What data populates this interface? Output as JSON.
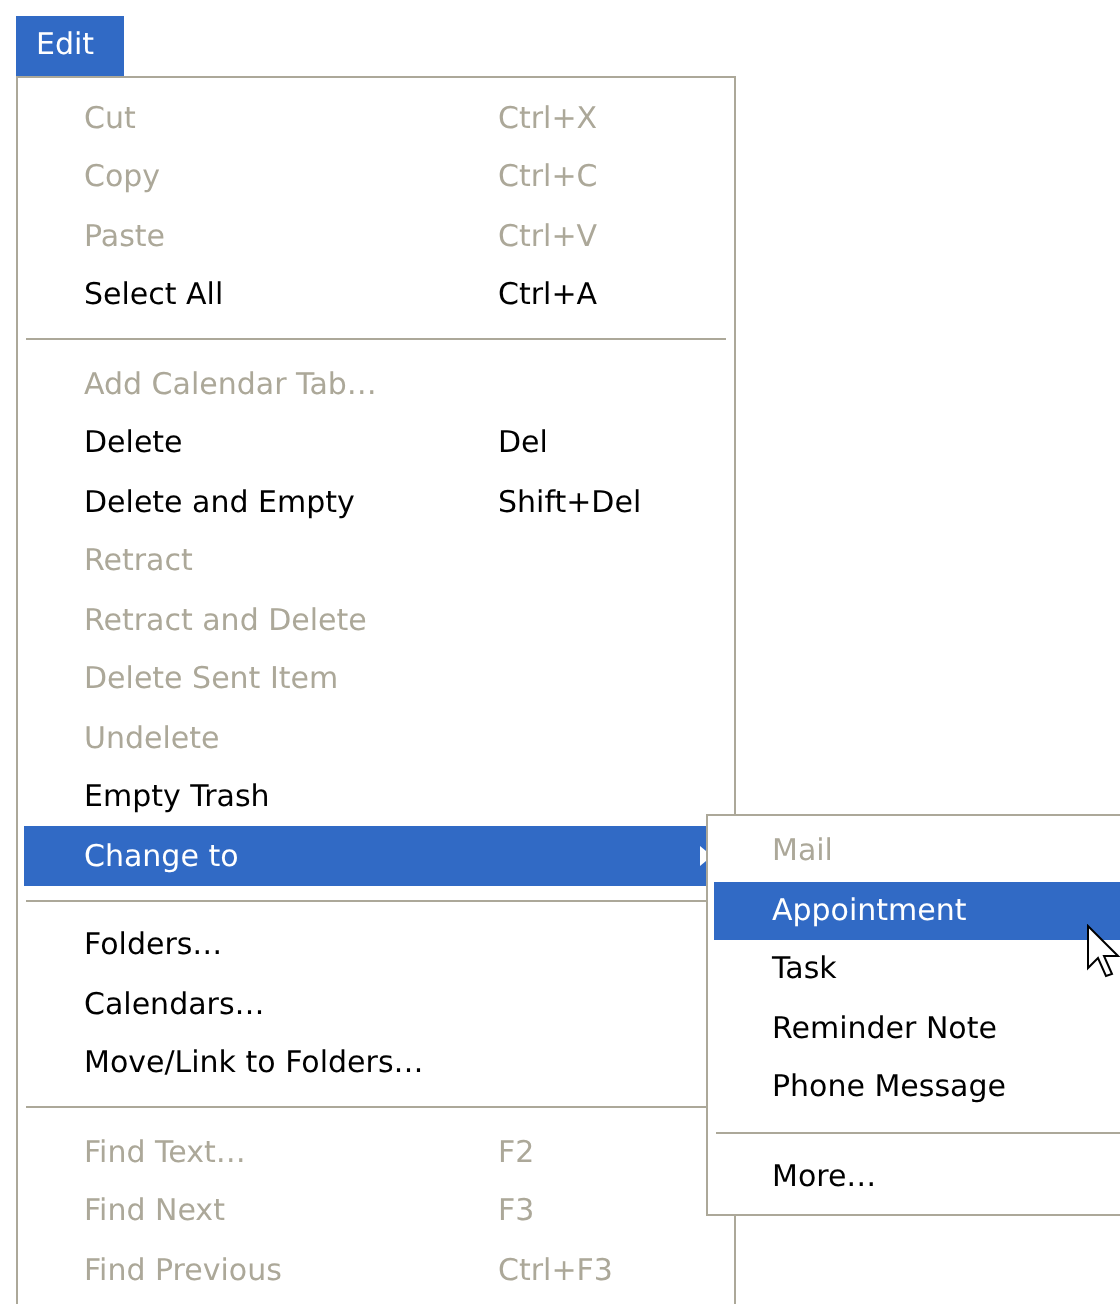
{
  "menu": {
    "title": "Edit",
    "items": [
      {
        "kind": "item",
        "label": "Cut",
        "shortcut": "Ctrl+X",
        "disabled": true,
        "selected": false
      },
      {
        "kind": "item",
        "label": "Copy",
        "shortcut": "Ctrl+C",
        "disabled": true,
        "selected": false
      },
      {
        "kind": "item",
        "label": "Paste",
        "shortcut": "Ctrl+V",
        "disabled": true,
        "selected": false
      },
      {
        "kind": "item",
        "label": "Select All",
        "shortcut": "Ctrl+A",
        "disabled": false,
        "selected": false
      },
      {
        "kind": "separator"
      },
      {
        "kind": "item",
        "label": "Add Calendar Tab…",
        "disabled": true,
        "selected": false
      },
      {
        "kind": "item",
        "label": "Delete",
        "shortcut": "Del",
        "disabled": false,
        "selected": false
      },
      {
        "kind": "item",
        "label": "Delete and Empty",
        "shortcut": "Shift+Del",
        "disabled": false,
        "selected": false
      },
      {
        "kind": "item",
        "label": "Retract",
        "disabled": true,
        "selected": false
      },
      {
        "kind": "item",
        "label": "Retract and Delete",
        "disabled": true,
        "selected": false
      },
      {
        "kind": "item",
        "label": "Delete Sent Item",
        "disabled": true,
        "selected": false
      },
      {
        "kind": "item",
        "label": "Undelete",
        "disabled": true,
        "selected": false
      },
      {
        "kind": "item",
        "label": "Empty Trash",
        "disabled": false,
        "selected": false
      },
      {
        "kind": "submenu",
        "label": "Change to",
        "disabled": false,
        "selected": true,
        "items": [
          {
            "kind": "item",
            "label": "Mail",
            "disabled": true,
            "selected": false
          },
          {
            "kind": "item",
            "label": "Appointment",
            "disabled": false,
            "selected": true
          },
          {
            "kind": "item",
            "label": "Task",
            "disabled": false,
            "selected": false
          },
          {
            "kind": "item",
            "label": "Reminder Note",
            "disabled": false,
            "selected": false
          },
          {
            "kind": "item",
            "label": "Phone Message",
            "disabled": false,
            "selected": false
          },
          {
            "kind": "separator"
          },
          {
            "kind": "item",
            "label": "More…",
            "disabled": false,
            "selected": false
          }
        ]
      },
      {
        "kind": "separator"
      },
      {
        "kind": "item",
        "label": "Folders…",
        "disabled": false,
        "selected": false
      },
      {
        "kind": "item",
        "label": "Calendars…",
        "disabled": false,
        "selected": false
      },
      {
        "kind": "item",
        "label": "Move/Link to Folders…",
        "disabled": false,
        "selected": false
      },
      {
        "kind": "separator"
      },
      {
        "kind": "item",
        "label": "Find Text…",
        "shortcut": "F2",
        "disabled": true,
        "selected": false
      },
      {
        "kind": "item",
        "label": "Find Next",
        "shortcut": "F3",
        "disabled": true,
        "selected": false
      },
      {
        "kind": "item",
        "label": "Find Previous",
        "shortcut": "Ctrl+F3",
        "disabled": true,
        "selected": false
      }
    ]
  }
}
